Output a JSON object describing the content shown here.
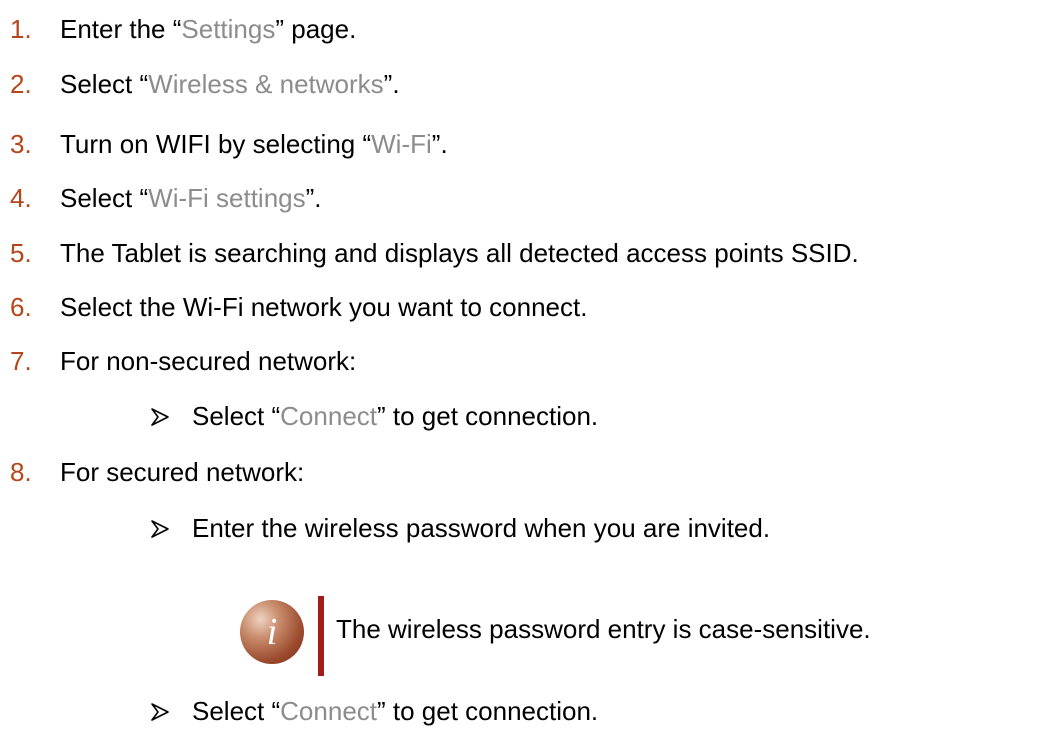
{
  "steps": [
    {
      "num": "1.",
      "before": "Enter the “",
      "hl": "Settings",
      "after": "” page."
    },
    {
      "num": "2.",
      "before": "Select “",
      "hl": "Wireless & networks",
      "after": "”."
    },
    {
      "num": "3.",
      "before": "Turn on WIFI by selecting “",
      "hl": "Wi-Fi",
      "after": "”."
    },
    {
      "num": "4.",
      "before": "Select “",
      "hl": "Wi-Fi settings",
      "after": "”."
    },
    {
      "num": "5.",
      "text": "The Tablet is searching and displays all detected access points SSID."
    },
    {
      "num": "6.",
      "text": "Select the Wi-Fi network you want to connect."
    },
    {
      "num": "7.",
      "text": "For non-secured network:"
    },
    {
      "num": "8.",
      "text": "For secured network:"
    }
  ],
  "sub_items": [
    {
      "before": "Select “",
      "hl": "Connect",
      "after": "” to get connection."
    },
    {
      "text": "Enter the wireless password when you are invited."
    },
    {
      "before": "Select “",
      "hl": "Connect",
      "after": "” to get connection."
    }
  ],
  "note": {
    "icon_letter": "i",
    "text": "The wireless password entry is case-sensitive."
  },
  "colors": {
    "step_number": "#b5461a",
    "highlight": "#8c8c8c",
    "note_bar": "#a31b14",
    "icon": "#9b4a2d"
  },
  "icons": {
    "bullet": "arrowhead-bullet-icon",
    "note": "info-icon"
  }
}
